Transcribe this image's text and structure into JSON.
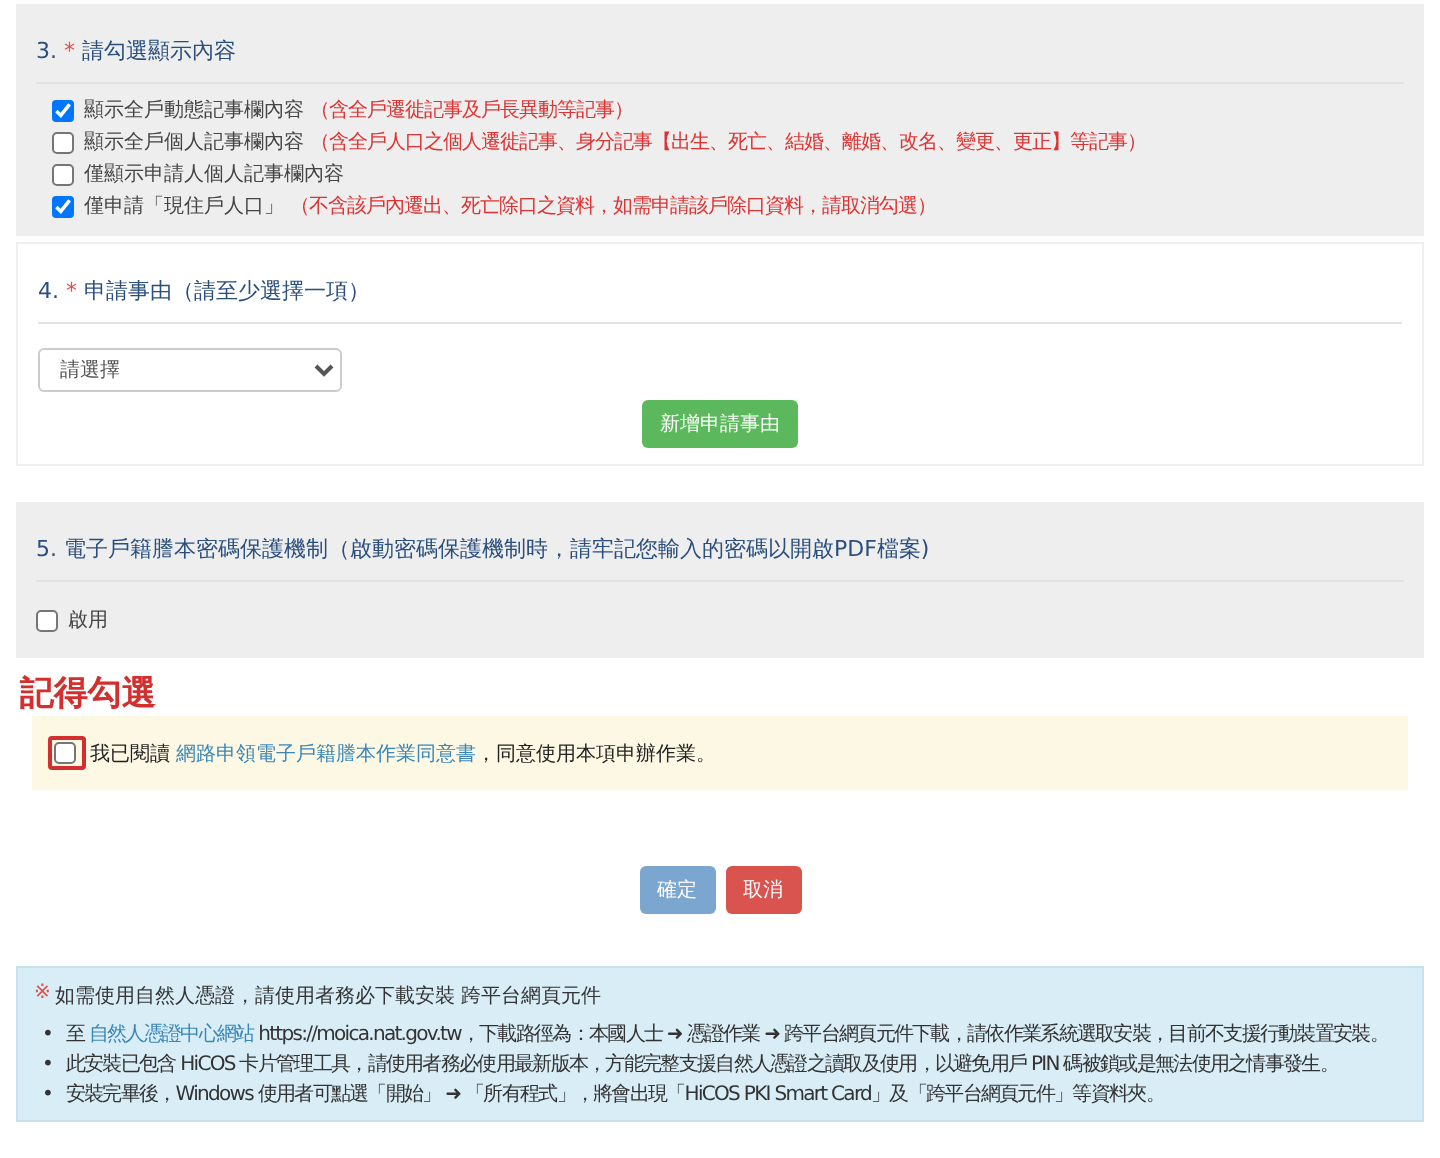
{
  "section_3": {
    "number": "3.",
    "required": "*",
    "title": "請勾選顯示內容",
    "options": [
      {
        "label": "顯示全戶動態記事欄內容",
        "note": "（含全戶遷徙記事及戶長異動等記事）",
        "checked": true
      },
      {
        "label": "顯示全戶個人記事欄內容",
        "note": "（含全戶人口之個人遷徙記事、身分記事【出生、死亡、結婚、離婚、改名、變更、更正】等記事）",
        "checked": false
      },
      {
        "label": "僅顯示申請人個人記事欄內容",
        "checked": false
      },
      {
        "label": "僅申請「現住戶人口」",
        "note": "（不含該戶內遷出、死亡除口之資料，如需申請該戶除口資料，請取消勾選）",
        "checked": true
      }
    ]
  },
  "section_4": {
    "number": "4.",
    "required": "*",
    "title": "申請事由（請至少選擇一項）",
    "select": {
      "value": "請選擇"
    },
    "add_button": "新增申請事由"
  },
  "section_5": {
    "title": "5. 電子戶籍謄本密碼保護機制（啟動密碼保護機制時，請牢記您輸入的密碼以開啟PDF檔案)",
    "option": {
      "label": "啟用",
      "checked": false
    }
  },
  "annotation": "記得勾選",
  "agreement": {
    "checked": false,
    "prefix": "我已閱讀 ",
    "link": "網路申領電子戶籍謄本作業同意書",
    "suffix": "，同意使用本項申辦作業。"
  },
  "buttons": [
    {
      "label": "確定",
      "kind": "primary"
    },
    {
      "label": "取消",
      "kind": "danger"
    }
  ],
  "info": {
    "mark": "※",
    "bullet": "•",
    "heading": "如需使用自然人憑證，請使用者務必下載安裝 跨平台網頁元件",
    "items": [
      {
        "prefix": "至 ",
        "link": "自然人憑證中心網站",
        "suffix": " https://moica.nat.gov.tw，下載路徑為：本國人士 ➜ 憑證作業 ➜ 跨平台網頁元件下載，請依作業系統選取安裝，目前不支援行動裝置安裝。"
      },
      {
        "prefix": "此安裝已包含 HiCOS 卡片管理工具，請使用者務必使用最新版本，方能完整支援自然人憑證之讀取及使用，以避免用戶 PIN 碼被鎖或是無法使用之情事發生。"
      },
      {
        "prefix": "安裝完畢後，Windows 使用者可點選「開始」 ➜ 「所有程式」，將會出現「HiCOS PKI Smart Card」及「跨平台網頁元件」等資料夾。"
      }
    ]
  }
}
